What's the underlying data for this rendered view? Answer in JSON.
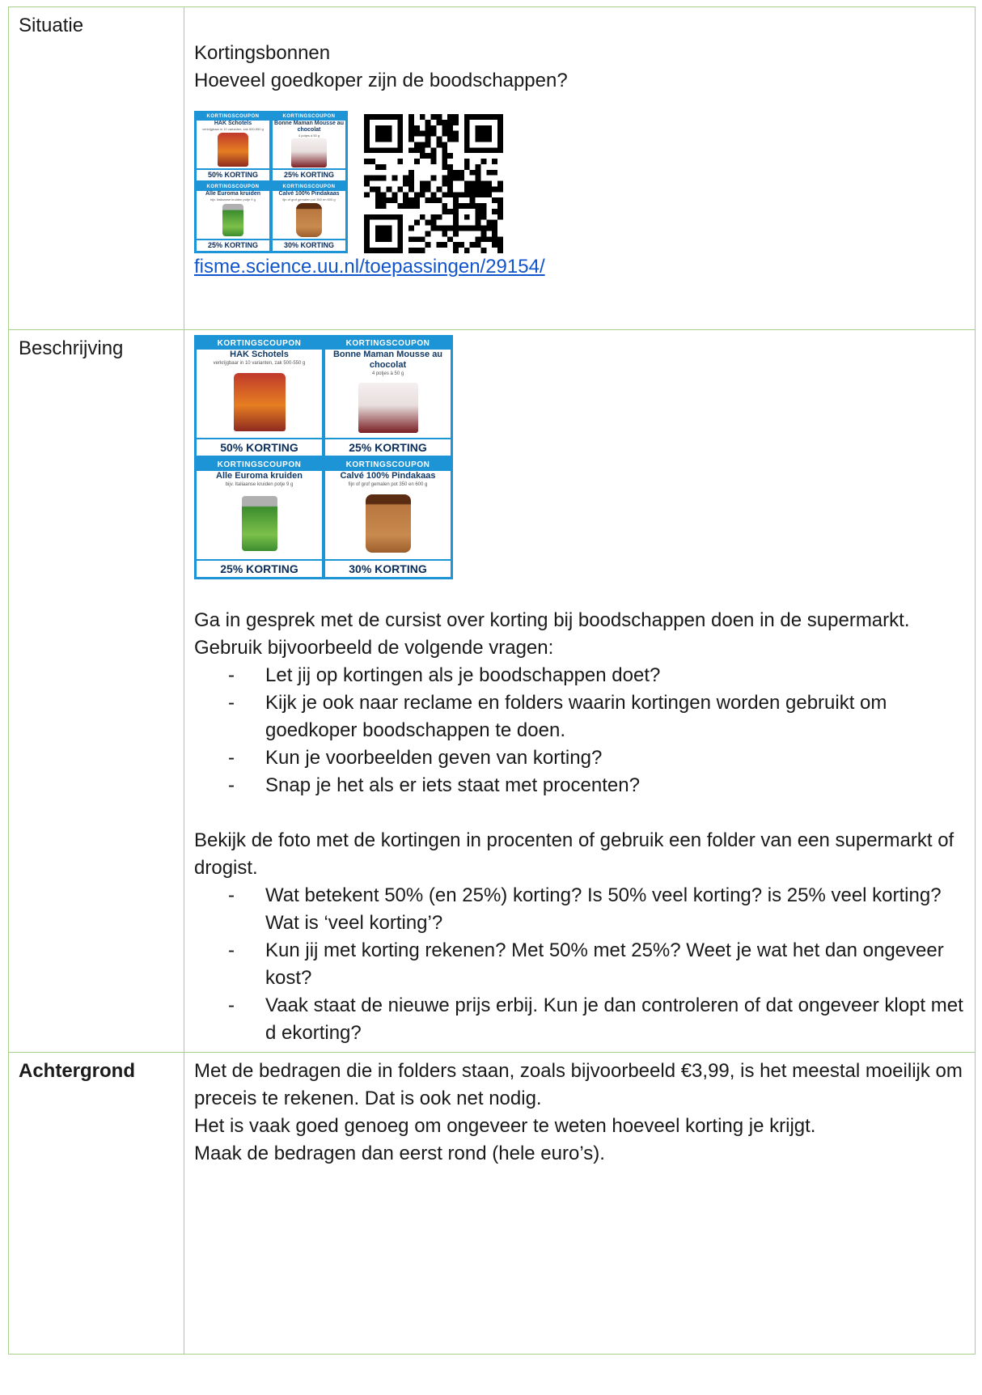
{
  "rows": {
    "situatie": {
      "label": "Situatie",
      "title": "Kortingsbonnen",
      "question": "Hoeveel goedkoper zijn de boodschappen?",
      "link": "fisme.science.uu.nl/toepassingen/29154/"
    },
    "beschrijving": {
      "label": "Beschrijving",
      "intro": [
        "Ga in gesprek met de cursist over korting bij boodschappen doen in de supermarkt.",
        "Gebruik  bijvoorbeeld de volgende vragen:"
      ],
      "questions1": [
        "Let jij op kortingen als je boodschappen doet?",
        "Kijk je ook naar reclame en folders waarin kortingen worden gebruikt om goedkoper boodschappen te doen.",
        "Kun je voorbeelden geven van korting?",
        "Snap je het als er iets staat met procenten?"
      ],
      "para2": "Bekijk de foto met de kortingen in procenten of gebruik een folder van een supermarkt of drogist.",
      "questions2": [
        "Wat betekent 50% (en 25%) korting? Is 50% veel korting? is 25% veel korting? Wat is ‘veel korting’?",
        "Kun jij met korting rekenen? Met 50% met 25%? Weet je wat het dan ongeveer kost?",
        "Vaak staat de nieuwe prijs erbij. Kun je dan controleren of dat ongeveer klopt met d ekorting?"
      ]
    },
    "achtergrond": {
      "label": "Achtergrond",
      "lines": [
        "Met de bedragen die in folders staan, zoals bijvoorbeeld €3,99, is het meestal moeilijk om preceis te rekenen. Dat is ook net nodig.",
        "Het is vaak goed genoeg om ongeveer te weten hoeveel korting je krijgt.",
        "Maak de bedragen dan eerst rond (hele euro’s)."
      ]
    }
  },
  "coupons": [
    {
      "header": "KORTINGSCOUPON",
      "title": "HAK Schotels",
      "sub": "verkrijgbaar in 10 varianten, zak 500-550 g",
      "discount": "50% KORTING",
      "product": "pouch"
    },
    {
      "header": "KORTINGSCOUPON",
      "title": "Bonne Maman Mousse au chocolat",
      "sub": "4 potjes à 50 g",
      "discount": "25% KORTING",
      "product": "cup"
    },
    {
      "header": "KORTINGSCOUPON",
      "title": "Alle Euroma kruiden",
      "sub": "bijv. Italiaanse kruiden potje 9 g",
      "discount": "25% KORTING",
      "product": "jar-herb"
    },
    {
      "header": "KORTINGSCOUPON",
      "title": "Calvé 100% Pindakaas",
      "sub": "fijn of grof gemalen pot 350 en 600 g",
      "discount": "30% KORTING",
      "product": "jar-pb"
    }
  ],
  "colors": {
    "border": "#a8d08d",
    "link": "#1155cc",
    "coupon_blue": "#1c94d6"
  },
  "icons": {
    "qr": "qr-code-icon"
  }
}
